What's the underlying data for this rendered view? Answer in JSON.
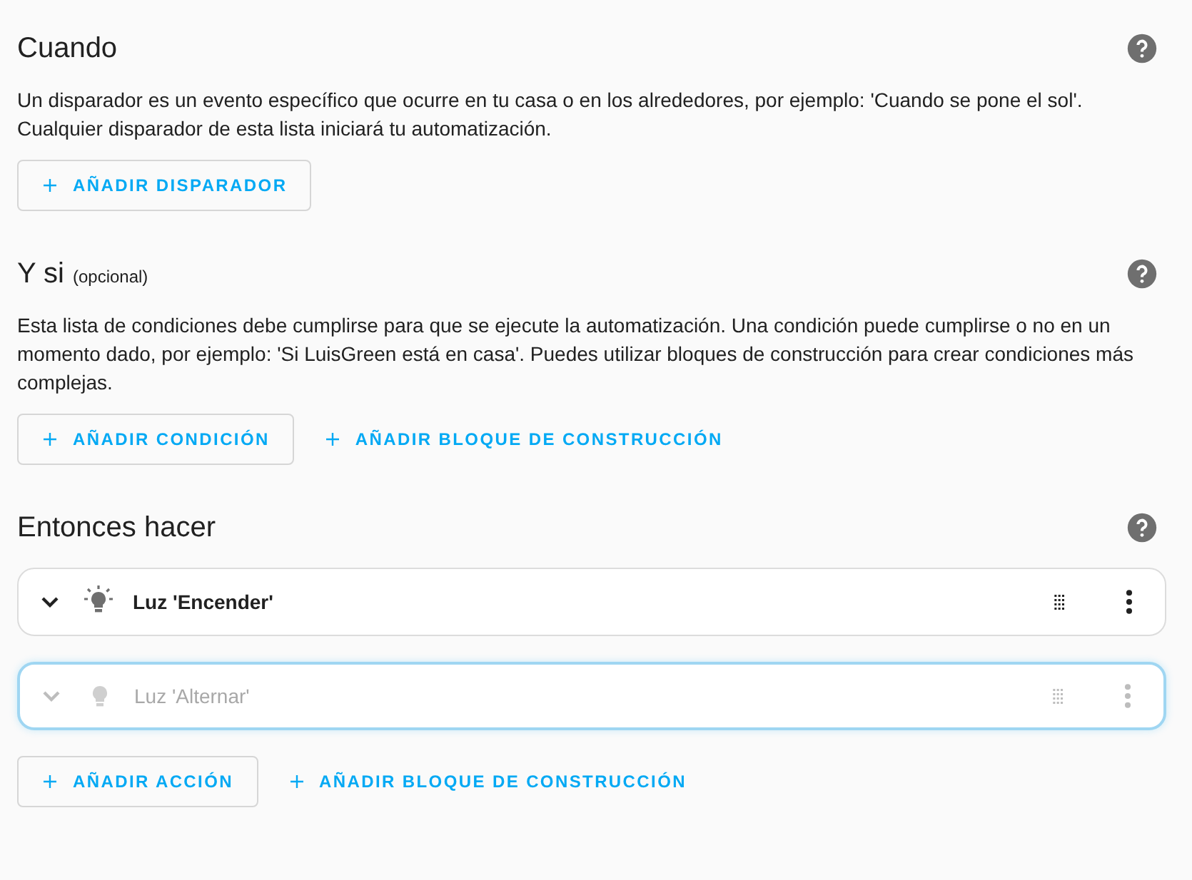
{
  "sections": [
    {
      "title": "Cuando",
      "description": "Un disparador es un evento específico que ocurre en tu casa o en los alrededores, por ejemplo: 'Cuando se pone el sol'. Cualquier disparador de esta lista iniciará tu automatización.",
      "buttons": [
        {
          "label": "AÑADIR DISPARADOR",
          "kind": "outlined"
        }
      ]
    },
    {
      "title": "Y si",
      "subtitle": "(opcional)",
      "description": "Esta lista de condiciones debe cumplirse para que se ejecute la automatización. Una condición puede cumplirse o no en un momento dado, por ejemplo: 'Si LuisGreen está en casa'. Puedes utilizar bloques de construcción para crear condiciones más complejas.",
      "buttons": [
        {
          "label": "AÑADIR CONDICIÓN",
          "kind": "outlined"
        },
        {
          "label": "AÑADIR BLOQUE DE CONSTRUCCIÓN",
          "kind": "text"
        }
      ]
    },
    {
      "title": "Entonces hacer",
      "actions": [
        {
          "label": "Luz 'Encender'",
          "dragging": false
        },
        {
          "label": "Luz 'Alternar'",
          "dragging": true
        }
      ],
      "buttons": [
        {
          "label": "AÑADIR ACCIÓN",
          "kind": "outlined"
        },
        {
          "label": "AÑADIR BLOQUE DE CONSTRUCCIÓN",
          "kind": "text"
        }
      ]
    }
  ]
}
